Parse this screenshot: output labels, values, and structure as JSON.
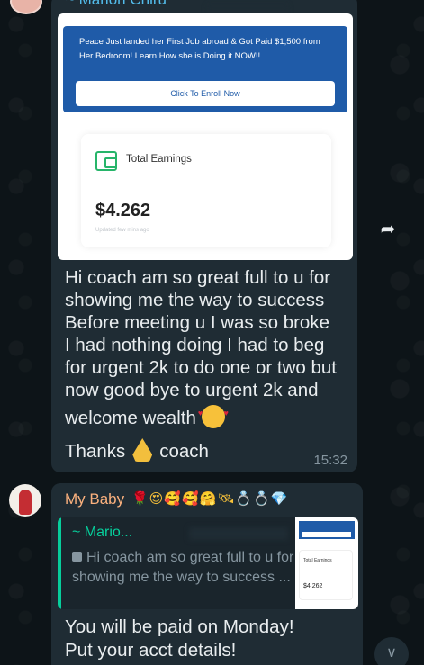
{
  "message1": {
    "sender": "~ Marion Chiru",
    "ad": {
      "banner_text": "Peace Just landed her First Job abroad & Got Paid $1,500 from Her Bedroom! Learn How she is Doing it NOW!!",
      "enroll_label": "Click To Enroll Now",
      "earnings_title": "Total Earnings",
      "earnings_amount": "$4.262",
      "earnings_sub": "Updated few mins ago"
    },
    "text_lines": [
      "Hi coach am so great full to u for",
      "showing me the way to success",
      "Before meeting u I was so broke",
      "I had nothing doing I had to beg",
      "for urgent 2k to do one or two but",
      "now good bye to urgent 2k and",
      "welcome wealth",
      "Thanks",
      "coach"
    ],
    "time": "15:32"
  },
  "message2": {
    "sender": "My Baby",
    "sender_emojis": "🌹😍🥰🥰🤗🛰💍💍💎",
    "quote": {
      "name": "~ Mario...",
      "text": "Hi coach am so great full to u for showing me the way to success ...",
      "thumb_label": "Total Earnings",
      "thumb_amount": "$4.262"
    },
    "text_lines": [
      "You will be paid on Monday!",
      "Put your acct details!"
    ]
  },
  "icons": {
    "forward": "forward-icon",
    "scroll": "chevron-double-down-icon"
  },
  "colors": {
    "background": "#0b141a",
    "bubble": "#1f2c34",
    "quote_accent": "#06cf9c",
    "sender2": "#fbb17e",
    "link_name": "#53bdeb"
  }
}
